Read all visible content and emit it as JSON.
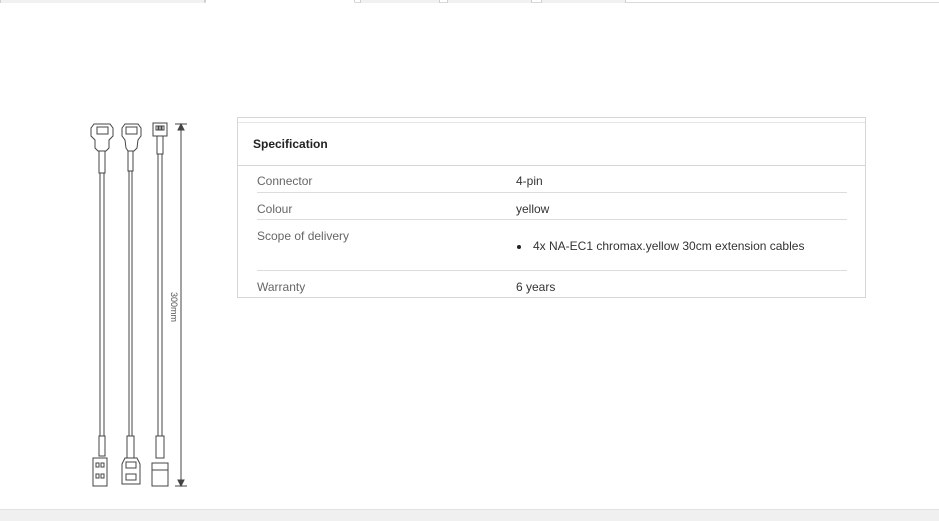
{
  "drawing": {
    "dimension_label": "300mm"
  },
  "spec": {
    "title": "Specification",
    "rows": [
      {
        "label": "Connector",
        "value": "4-pin"
      },
      {
        "label": "Colour",
        "value": "yellow"
      },
      {
        "label": "Scope of delivery",
        "items": [
          "4x NA-EC1 chromax.yellow 30cm extension cables"
        ]
      },
      {
        "label": "Warranty",
        "value": "6 years"
      }
    ]
  }
}
